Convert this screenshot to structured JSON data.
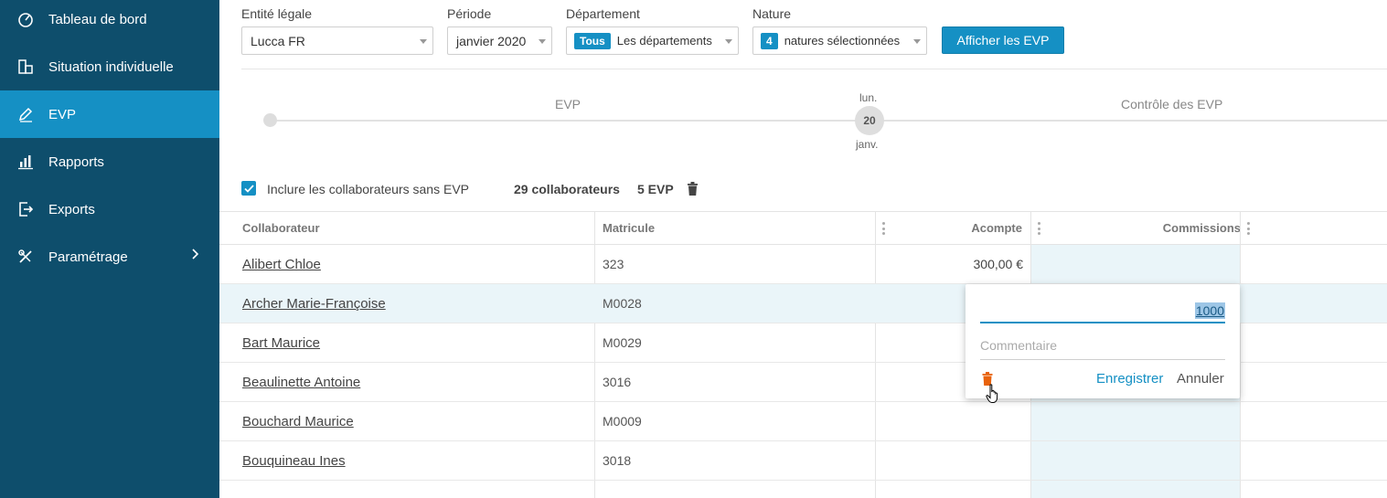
{
  "sidebar": {
    "items": [
      {
        "label": "Tableau de bord",
        "icon": "gauge-icon"
      },
      {
        "label": "Situation individuelle",
        "icon": "stack-icon"
      },
      {
        "label": "EVP",
        "icon": "pencil-icon",
        "active": true
      },
      {
        "label": "Rapports",
        "icon": "bar-chart-icon"
      },
      {
        "label": "Exports",
        "icon": "export-icon"
      },
      {
        "label": "Paramétrage",
        "icon": "tools-icon",
        "has_chevron": true
      }
    ]
  },
  "filters": {
    "entity": {
      "label": "Entité légale",
      "value": "Lucca FR"
    },
    "period": {
      "label": "Période",
      "value": "janvier 2020"
    },
    "department": {
      "label": "Département",
      "tag": "Tous",
      "value": "Les départements"
    },
    "nature": {
      "label": "Nature",
      "tag": "4",
      "value": "natures sélectionnées"
    },
    "submit_label": "Afficher les EVP"
  },
  "timeline": {
    "step1": "EVP",
    "step2": "Contrôle des EVP",
    "day_name": "lun.",
    "day_number": "20",
    "month": "janv."
  },
  "summary": {
    "include_label": "Inclure les collaborateurs sans EVP",
    "collaborators": "29 collaborateurs",
    "evp_count": "5 EVP"
  },
  "table": {
    "headers": {
      "collaborator": "Collaborateur",
      "matricule": "Matricule",
      "acompte": "Acompte",
      "commissions": "Commissions"
    },
    "rows": [
      {
        "name": "Alibert Chloe",
        "matricule": "323",
        "acompte": "300,00 €"
      },
      {
        "name": "Archer Marie-Françoise",
        "matricule": "M0028",
        "acompte": ""
      },
      {
        "name": "Bart Maurice",
        "matricule": "M0029",
        "acompte": ""
      },
      {
        "name": "Beaulinette Antoine",
        "matricule": "3016",
        "acompte": ""
      },
      {
        "name": "Bouchard Maurice",
        "matricule": "M0009",
        "acompte": ""
      },
      {
        "name": "Bouquineau Ines",
        "matricule": "3018",
        "acompte": ""
      }
    ]
  },
  "popover": {
    "value": "1000",
    "comment_placeholder": "Commentaire",
    "save_label": "Enregistrer",
    "cancel_label": "Annuler"
  },
  "colors": {
    "sidebar": "#0e4e6c",
    "accent": "#1590c4",
    "delete": "#e8620c",
    "row_highlight": "#eaf5f9"
  }
}
